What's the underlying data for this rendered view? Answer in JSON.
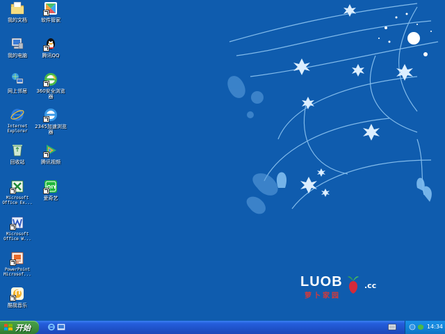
{
  "desktop_icons": [
    {
      "name": "my-documents",
      "label": "我的文档",
      "icon": "folder-documents-icon"
    },
    {
      "name": "software-manager",
      "label": "软件管家",
      "icon": "software-manager-icon"
    },
    {
      "name": "my-computer",
      "label": "我的电脑",
      "icon": "computer-icon"
    },
    {
      "name": "tencent-qq",
      "label": "腾讯QQ",
      "icon": "qq-penguin-icon"
    },
    {
      "name": "network-places",
      "label": "网上邻居",
      "icon": "network-icon"
    },
    {
      "name": "360-browser",
      "label": "360安全浏览\n器",
      "icon": "browser-360-icon"
    },
    {
      "name": "internet-explorer",
      "label": "Internet\nExplorer",
      "icon": "ie-icon"
    },
    {
      "name": "2345-browser",
      "label": "2345加速浏览\n器",
      "icon": "browser-2345-icon"
    },
    {
      "name": "recycle-bin",
      "label": "回收站",
      "icon": "recycle-bin-icon"
    },
    {
      "name": "tencent-video",
      "label": "腾讯视频",
      "icon": "tencent-video-icon"
    },
    {
      "name": "ms-excel",
      "label": "Microsoft\nOffice Ex...",
      "icon": "excel-icon"
    },
    {
      "name": "iqiyi",
      "label": "爱奇艺",
      "icon": "iqiyi-icon"
    },
    {
      "name": "ms-word",
      "label": "Microsoft\nOffice W...",
      "icon": "word-icon"
    },
    {
      "name": "powerpoint",
      "label": "PowerPoint\nMicrosof...",
      "icon": "powerpoint-icon"
    },
    {
      "name": "kuwo-music",
      "label": "酷我音乐",
      "icon": "kuwo-music-icon"
    }
  ],
  "brand": {
    "wordmark": "LUOB",
    "tld": ".cc",
    "tagline": "萝卜家园"
  },
  "taskbar": {
    "start_label": "开始",
    "clock": "14:34"
  },
  "colors": {
    "desktop_bg": "#0f5cae",
    "taskbar": "#245edc",
    "start_button": "#3c8e3c",
    "tray": "#1284d8"
  }
}
